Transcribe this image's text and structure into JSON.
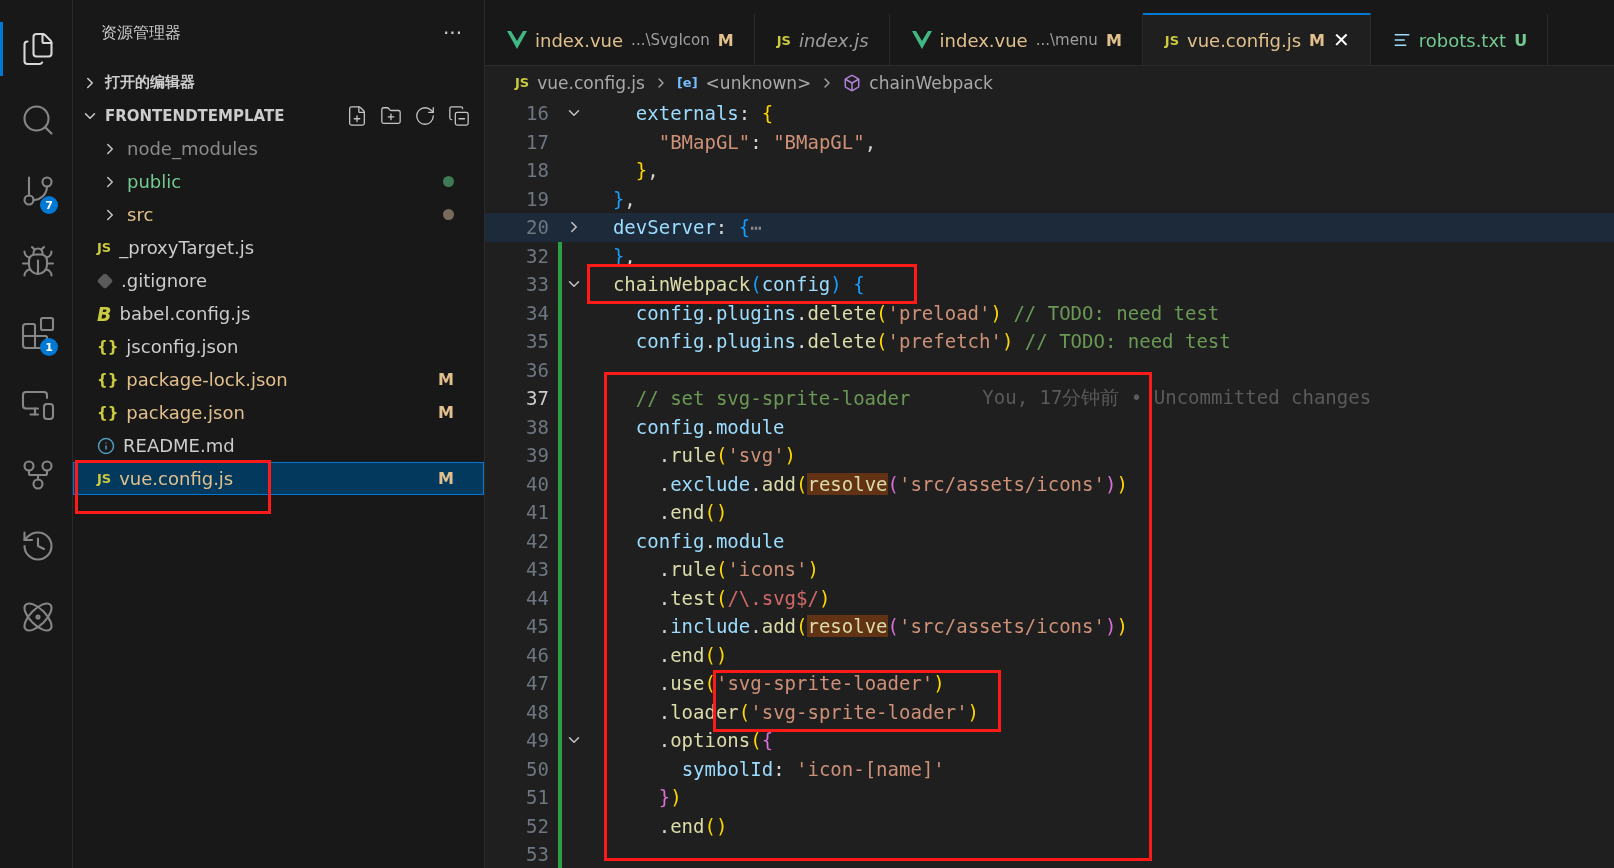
{
  "activity_bar": {
    "items": [
      {
        "kind": "files",
        "selected": true
      },
      {
        "kind": "search",
        "selected": false
      },
      {
        "kind": "source-control",
        "selected": false,
        "badge": "7"
      },
      {
        "kind": "run-debug",
        "selected": false
      },
      {
        "kind": "extensions",
        "selected": false,
        "badge": "1"
      },
      {
        "kind": "remote",
        "selected": false
      },
      {
        "kind": "git-graph",
        "selected": false
      },
      {
        "kind": "timeline",
        "selected": false
      },
      {
        "kind": "ai",
        "selected": false
      }
    ]
  },
  "sidebar": {
    "title": "资源管理器",
    "more": "···",
    "sections": [
      {
        "label": "打开的编辑器",
        "expanded": false
      },
      {
        "label": "FRONTENDTEMPLATE",
        "expanded": true
      }
    ],
    "items": [
      {
        "kind": "folder",
        "label": "node_modules",
        "color": "#8b8b8b",
        "expanded": false,
        "selected": false
      },
      {
        "kind": "folder",
        "label": "public",
        "color": "#73c991",
        "expanded": false,
        "selected": false,
        "decoration": {
          "color": "#3f7a55"
        }
      },
      {
        "kind": "folder",
        "label": "src",
        "color": "#e2c08d",
        "expanded": false,
        "selected": false,
        "decoration": {
          "color": "#776b5c"
        }
      },
      {
        "kind": "js",
        "icon": "JS",
        "label": "_proxyTarget.js",
        "color": "#cccccc",
        "selected": false
      },
      {
        "kind": "git",
        "label": ".gitignore",
        "color": "#cccccc",
        "selected": false
      },
      {
        "kind": "babel",
        "icon": "B",
        "label": "babel.config.js",
        "color": "#cccccc",
        "selected": false
      },
      {
        "kind": "json",
        "icon": "{}",
        "label": "jsconfig.json",
        "color": "#cccccc",
        "selected": false
      },
      {
        "kind": "json",
        "icon": "{}",
        "label": "package-lock.json",
        "color": "#e2c08d",
        "selected": false,
        "status": "M"
      },
      {
        "kind": "json",
        "icon": "{}",
        "label": "package.json",
        "color": "#e2c08d",
        "selected": false,
        "status": "M"
      },
      {
        "kind": "info",
        "label": "README.md",
        "color": "#cccccc",
        "selected": false
      },
      {
        "kind": "js",
        "icon": "JS",
        "label": "vue.config.js",
        "color": "#e2c08d",
        "selected": true,
        "status": "M"
      }
    ]
  },
  "tabs": [
    {
      "kind": "vue",
      "label": "index.vue",
      "path": "...\\SvgIcon",
      "status": "M",
      "color": "#e2c08d",
      "selected": false,
      "preview": false
    },
    {
      "kind": "js",
      "icon": "JS",
      "label": "index.js",
      "color": "#9d9d9d",
      "selected": false,
      "preview": true
    },
    {
      "kind": "vue",
      "label": "index.vue",
      "path": "...\\menu",
      "status": "M",
      "color": "#e2c08d",
      "selected": false,
      "preview": false
    },
    {
      "kind": "js",
      "icon": "JS",
      "label": "vue.config.js",
      "status": "M",
      "color": "#e2c08d",
      "selected": true,
      "preview": false,
      "close": "✕"
    },
    {
      "kind": "txt",
      "label": "robots.txt",
      "status": "U",
      "color": "#73c991",
      "selected": false,
      "preview": false
    }
  ],
  "breadcrumb": [
    {
      "kind": "js",
      "icon": "JS",
      "label": "vue.config.js"
    },
    {
      "kind": "variable",
      "icon": "[e]",
      "label": "<unknown>"
    },
    {
      "kind": "method",
      "label": "chainWebpack"
    }
  ],
  "editor": {
    "lines": [
      {
        "number": "16",
        "code": "    externals: {",
        "collapsible": true,
        "collapsed": false,
        "modified": false,
        "current": false
      },
      {
        "number": "17",
        "code": "      \"BMapGL\": \"BMapGL\",",
        "modified": false,
        "current": false
      },
      {
        "number": "18",
        "code": "    },",
        "modified": false,
        "current": false
      },
      {
        "number": "19",
        "code": "  },",
        "modified": false,
        "current": false
      },
      {
        "number": "20",
        "code": "  devServer: {⋯",
        "collapsible": true,
        "collapsed": true,
        "modified": false,
        "current": false,
        "highlighted": true
      },
      {
        "number": "32",
        "code": "  },",
        "modified": true,
        "current": false
      },
      {
        "number": "33",
        "code": "  chainWebpack(config) {",
        "collapsible": true,
        "collapsed": false,
        "modified": true,
        "current": false
      },
      {
        "number": "34",
        "code": "    config.plugins.delete('preload') // TODO: need test",
        "modified": true,
        "current": false
      },
      {
        "number": "35",
        "code": "    config.plugins.delete('prefetch') // TODO: need test",
        "modified": true,
        "current": false
      },
      {
        "number": "36",
        "modified": true,
        "current": false
      },
      {
        "number": "37",
        "code": "    // set svg-sprite-loader",
        "blame": "You, 17分钟前 • Uncommitted changes",
        "modified": true,
        "current": true
      },
      {
        "number": "38",
        "code": "    config.module",
        "modified": true,
        "current": false
      },
      {
        "number": "39",
        "code": "      .rule('svg')",
        "modified": true,
        "current": false
      },
      {
        "number": "40",
        "code": "      .exclude.add(resolve('src/assets/icons'))",
        "word_highlight": true,
        "modified": true,
        "current": false
      },
      {
        "number": "41",
        "code": "      .end()",
        "modified": true,
        "current": false
      },
      {
        "number": "42",
        "code": "    config.module",
        "modified": true,
        "current": false
      },
      {
        "number": "43",
        "code": "      .rule('icons')",
        "modified": true,
        "current": false
      },
      {
        "number": "44",
        "code": "      .test(/\\.svg$/)",
        "modified": true,
        "current": false
      },
      {
        "number": "45",
        "code": "      .include.add(resolve('src/assets/icons'))",
        "word_highlight": true,
        "modified": true,
        "current": false
      },
      {
        "number": "46",
        "code": "      .end()",
        "modified": true,
        "current": false
      },
      {
        "number": "47",
        "code": "      .use('svg-sprite-loader')",
        "modified": true,
        "current": false
      },
      {
        "number": "48",
        "code": "      .loader('svg-sprite-loader')",
        "modified": true,
        "current": false
      },
      {
        "number": "49",
        "code": "      .options({",
        "collapsible": true,
        "collapsed": false,
        "modified": true,
        "current": false
      },
      {
        "number": "50",
        "code": "        symbolId: 'icon-[name]'",
        "modified": true,
        "current": false
      },
      {
        "number": "51",
        "code": "      })",
        "modified": true,
        "current": false
      },
      {
        "number": "52",
        "code": "      .end()",
        "modified": true,
        "current": false
      },
      {
        "number": "53",
        "modified": true,
        "current": false
      }
    ]
  }
}
